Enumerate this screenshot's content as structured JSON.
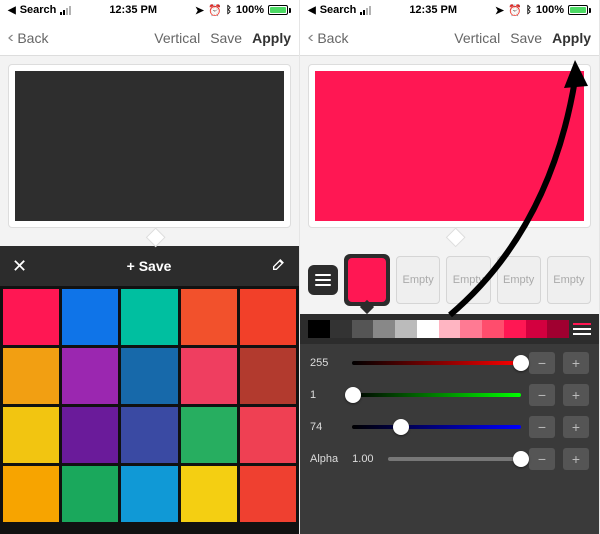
{
  "status": {
    "back_to": "Search",
    "time": "12:35 PM",
    "battery_pct": "100%",
    "icons": {
      "nav": "nav-icon",
      "alarm": "alarm-icon",
      "bt": "bluetooth-icon"
    }
  },
  "nav": {
    "back": "Back",
    "actions": {
      "vertical": "Vertical",
      "save": "Save",
      "apply": "Apply"
    }
  },
  "left": {
    "canvas_color": "#2e2e2e",
    "palette_bar": {
      "save": "+ Save"
    },
    "swatches": [
      "#ff1753",
      "#0f74e8",
      "#00bfa0",
      "#f2512c",
      "#f24029",
      "#f29f12",
      "#9b27b0",
      "#1769aa",
      "#ef3e60",
      "#b23a2e",
      "#f2c511",
      "#6a1b9a",
      "#3a4aa3",
      "#27ae60",
      "#ef4053",
      "#f7a400",
      "#1aa85c",
      "#1099d6",
      "#f4cf12",
      "#ef4030"
    ]
  },
  "right": {
    "canvas_color": "#ff1753",
    "slots": {
      "empty_label": "Empty",
      "selected_color": "#ff1753"
    },
    "strip": [
      "#000000",
      "#333333",
      "#555555",
      "#888888",
      "#bbbbbb",
      "#ffffff",
      "#ffb5c2",
      "#ff7a93",
      "#ff4d6d",
      "#ff1753",
      "#d3003f",
      "#a00030"
    ],
    "sliders": {
      "r": {
        "label": "255",
        "value": 255,
        "max": 255,
        "track": "linear-gradient(to right,#000,#ff0000)"
      },
      "g": {
        "label": "1",
        "value": 1,
        "max": 255,
        "track": "linear-gradient(to right,#000,#00ff00)"
      },
      "b": {
        "label": "74",
        "value": 74,
        "max": 255,
        "track": "linear-gradient(to right,#000,#0000ff)"
      },
      "a": {
        "label": "Alpha",
        "value_text": "1.00",
        "value": 1,
        "max": 1,
        "track": "#777"
      }
    }
  }
}
